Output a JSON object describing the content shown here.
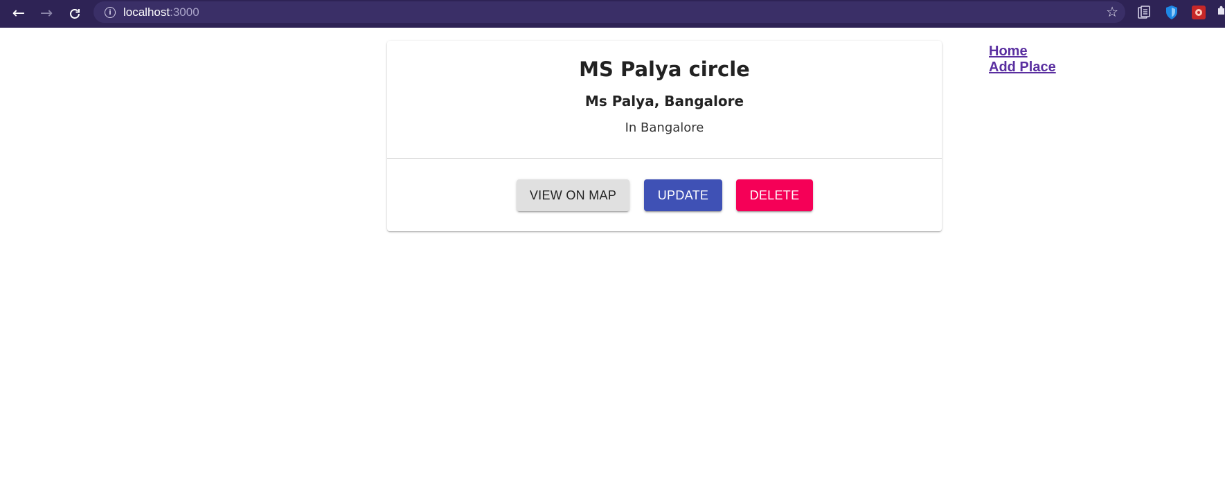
{
  "browser": {
    "url_host": "localhost",
    "url_port": ":3000",
    "accent_color": "#2e2355"
  },
  "card": {
    "title": "MS Palya circle",
    "address": "Ms Palya, Bangalore",
    "description": "In Bangalore",
    "actions": {
      "view_on_map": "VIEW ON MAP",
      "update": "UPDATE",
      "delete": "DELETE"
    },
    "colors": {
      "update_button": "#3f51b5",
      "delete_button": "#f50057",
      "map_button": "#e0e0e0"
    }
  },
  "nav": {
    "links": [
      {
        "label": "Home"
      },
      {
        "label": "Add Place"
      }
    ],
    "link_color": "#5a2fa0"
  }
}
